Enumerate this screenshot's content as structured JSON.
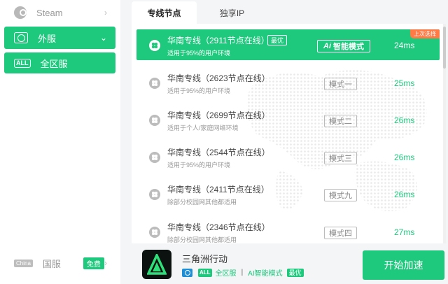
{
  "sidebar": {
    "steam": "Steam",
    "foreign": "外服",
    "all_regions": "全区服",
    "all_badge": "ALL",
    "china_badge": "China",
    "china": "国服",
    "free": "免费"
  },
  "tabs": [
    "专线节点",
    "独享IP"
  ],
  "rows": [
    {
      "title": "华南专线（2911节点在线）",
      "sub": "适用于95%的用户环境",
      "mode": "智能模式",
      "mode_prefix": "Ai",
      "ms": "24ms",
      "best": "最优",
      "last": "上次选择"
    },
    {
      "title": "华南专线（2623节点在线）",
      "sub": "适用于95%的用户环境",
      "mode": "模式一",
      "ms": "25ms"
    },
    {
      "title": "华南专线（2699节点在线）",
      "sub": "适用于个人/家庭网络环境",
      "mode": "模式二",
      "ms": "26ms"
    },
    {
      "title": "华南专线（2544节点在线）",
      "sub": "适用于95%的用户环境",
      "mode": "模式三",
      "ms": "26ms"
    },
    {
      "title": "华南专线（2411节点在线）",
      "sub": "除部分校园网其他都适用",
      "mode": "模式九",
      "ms": "26ms"
    },
    {
      "title": "华南专线（2346节点在线）",
      "sub": "除部分校园网其他都适用",
      "mode": "模式四",
      "ms": "27ms"
    }
  ],
  "game": {
    "name": "三角洲行动",
    "all_tag": "ALL",
    "region": "全区服",
    "mode": "AI智能模式",
    "best": "最优"
  },
  "start_button": "开始加速",
  "colors": {
    "accent": "#1ec97d",
    "last_select": "#ff7a45"
  }
}
